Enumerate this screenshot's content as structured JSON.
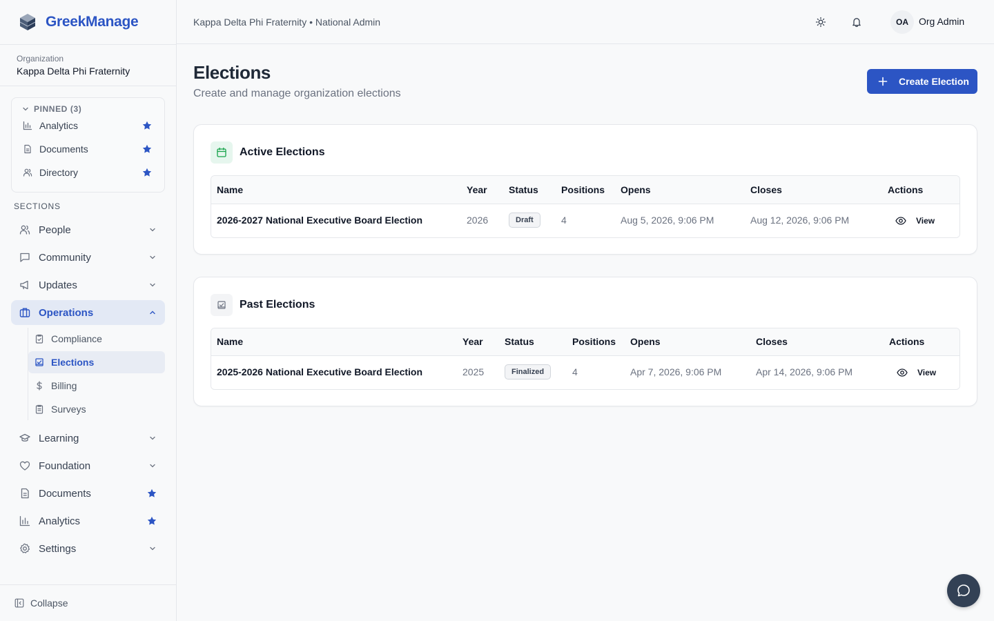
{
  "brand": {
    "name": "GreekManage"
  },
  "organization": {
    "label": "Organization",
    "name": "Kappa Delta Phi Fraternity"
  },
  "pinned": {
    "header": "PINNED (3)",
    "items": [
      {
        "label": "Analytics",
        "icon": "bar-chart-icon"
      },
      {
        "label": "Documents",
        "icon": "file-icon"
      },
      {
        "label": "Directory",
        "icon": "users-icon"
      }
    ]
  },
  "sections": {
    "label": "SECTIONS",
    "items": [
      {
        "label": "People",
        "icon": "users-icon"
      },
      {
        "label": "Community",
        "icon": "message-square-icon"
      },
      {
        "label": "Updates",
        "icon": "megaphone-icon"
      },
      {
        "label": "Operations",
        "icon": "briefcase-icon",
        "active": true
      },
      {
        "label": "Learning",
        "icon": "graduation-cap-icon"
      },
      {
        "label": "Foundation",
        "icon": "heart-icon"
      },
      {
        "label": "Documents",
        "icon": "file-icon",
        "pinned": true
      },
      {
        "label": "Analytics",
        "icon": "bar-chart-icon",
        "pinned": true
      },
      {
        "label": "Settings",
        "icon": "gear-icon"
      }
    ],
    "operations_children": [
      {
        "label": "Compliance",
        "icon": "clipboard-check-icon"
      },
      {
        "label": "Elections",
        "icon": "vote-icon",
        "active": true
      },
      {
        "label": "Billing",
        "icon": "dollar-icon"
      },
      {
        "label": "Surveys",
        "icon": "clipboard-icon"
      }
    ]
  },
  "collapse_label": "Collapse",
  "header": {
    "breadcrumb": "Kappa Delta Phi Fraternity • National Admin",
    "user_initials": "OA",
    "user_name": "Org Admin"
  },
  "page": {
    "title": "Elections",
    "subtitle": "Create and manage organization elections",
    "create_button": "Create Election"
  },
  "active_elections": {
    "title": "Active Elections",
    "columns": [
      "Name",
      "Year",
      "Status",
      "Positions",
      "Opens",
      "Closes",
      "Actions"
    ],
    "rows": [
      {
        "name": "2026-2027 National Executive Board Election",
        "year": "2026",
        "status": "Draft",
        "positions": "4",
        "opens": "Aug 5, 2026, 9:06 PM",
        "closes": "Aug 12, 2026, 9:06 PM",
        "action": "View"
      }
    ]
  },
  "past_elections": {
    "title": "Past Elections",
    "columns": [
      "Name",
      "Year",
      "Status",
      "Positions",
      "Opens",
      "Closes",
      "Actions"
    ],
    "rows": [
      {
        "name": "2025-2026 National Executive Board Election",
        "year": "2025",
        "status": "Finalized",
        "positions": "4",
        "opens": "Apr 7, 2026, 9:06 PM",
        "closes": "Apr 14, 2026, 9:06 PM",
        "action": "View"
      }
    ]
  },
  "colors": {
    "brand": "#2c55c4",
    "active_nav_bg": "#e3e9f5",
    "active_icon_bg": "#e6f6ee",
    "active_icon": "#16a34a",
    "fab": "#334155"
  }
}
